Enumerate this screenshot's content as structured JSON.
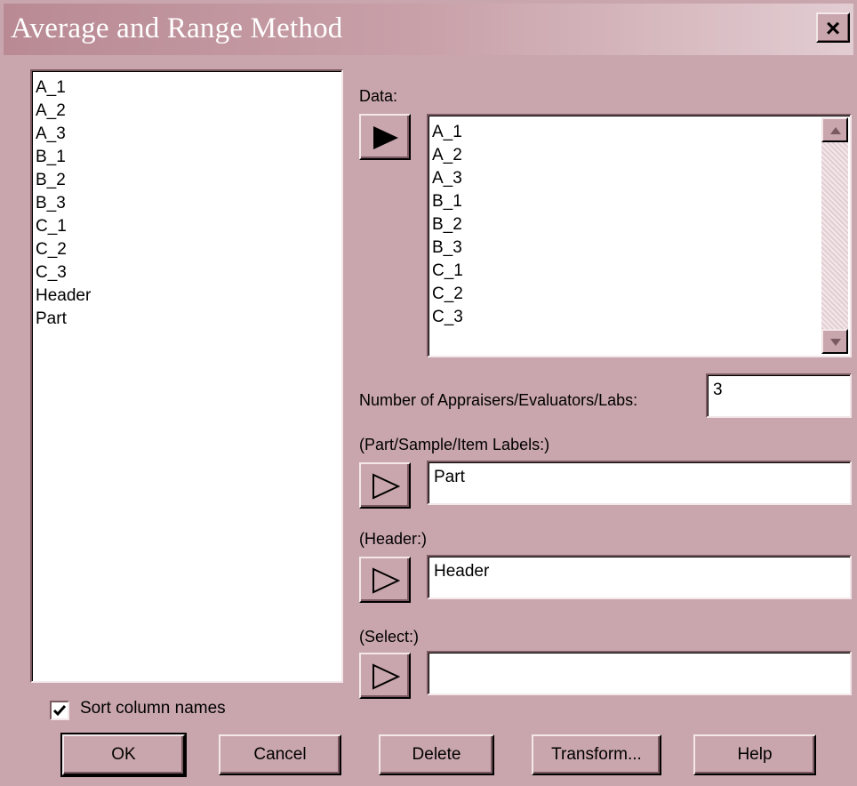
{
  "window": {
    "title": "Average and Range Method",
    "close_label": "×"
  },
  "variables_list": [
    "A_1",
    "A_2",
    "A_3",
    "B_1",
    "B_2",
    "B_3",
    "C_1",
    "C_2",
    "C_3",
    "Header",
    "Part"
  ],
  "data_field": {
    "label": "Data:",
    "items": [
      "A_1",
      "A_2",
      "A_3",
      "B_1",
      "B_2",
      "B_3",
      "C_1",
      "C_2",
      "C_3"
    ]
  },
  "appraisers": {
    "label": "Number of Appraisers/Evaluators/Labs:",
    "value": "3"
  },
  "part_labels": {
    "label": "(Part/Sample/Item Labels:)",
    "value": "Part"
  },
  "header_field": {
    "label": "(Header:)",
    "value": "Header"
  },
  "select_field": {
    "label": "(Select:)",
    "value": ""
  },
  "sort_option": {
    "label": "Sort column names",
    "checked": true
  },
  "buttons": {
    "ok": "OK",
    "cancel": "Cancel",
    "delete": "Delete",
    "transform": "Transform...",
    "help": "Help"
  },
  "icons": {
    "data_arrow": "filled-right-arrow-icon",
    "field_arrow": "outline-right-arrow-icon",
    "check": "checkmark-icon"
  },
  "colors": {
    "dialog_bg": "#c9a6ad",
    "title_text": "#ffffff"
  }
}
